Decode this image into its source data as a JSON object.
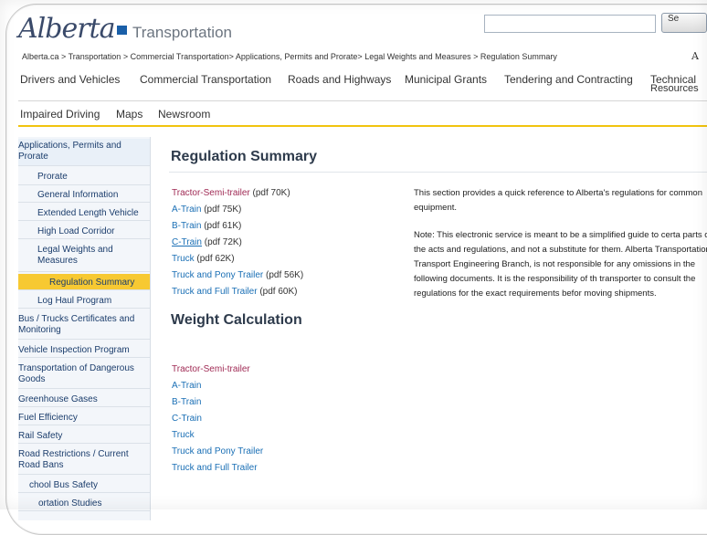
{
  "header": {
    "logo_text": "Alberta",
    "dept": "Transportation",
    "search_button": "Se"
  },
  "breadcrumb": "Alberta.ca > Transportation > Commercial Transportation> Applications, Permits and Prorate> Legal Weights and Measures > Regulation Summary",
  "font_size_label": "A",
  "nav_primary": [
    "Drivers and Vehicles",
    "Commercial Transportation",
    "Roads and Highways",
    "Municipal Grants",
    "Tendering and Contracting",
    "Technical",
    "Resources"
  ],
  "nav_secondary": [
    "Impaired Driving",
    "Maps",
    "Newsroom"
  ],
  "sidebar": [
    {
      "label": "Applications, Permits and Prorate",
      "level": "top"
    },
    {
      "label": "Prorate",
      "level": "sub"
    },
    {
      "label": "General Information",
      "level": "sub"
    },
    {
      "label": "Extended Length Vehicle",
      "level": "sub"
    },
    {
      "label": "High Load Corridor",
      "level": "sub"
    },
    {
      "label": "Legal Weights and Measures",
      "level": "sub"
    },
    {
      "label": "Regulation Summary",
      "level": "active"
    },
    {
      "label": "Log Haul Program",
      "level": "sub"
    },
    {
      "label": "Bus / Trucks Certificates and Monitoring",
      "level": "top"
    },
    {
      "label": "Vehicle Inspection Program",
      "level": "top"
    },
    {
      "label": "Transportation of Dangerous Goods",
      "level": "top"
    },
    {
      "label": "Greenhouse Gases",
      "level": "top"
    },
    {
      "label": "Fuel Efficiency",
      "level": "top"
    },
    {
      "label": "Rail Safety",
      "level": "top"
    },
    {
      "label": "Road Restrictions / Current Road Bans",
      "level": "top"
    },
    {
      "label": "chool Bus Safety",
      "level": "top"
    },
    {
      "label": "ortation Studies",
      "level": "top"
    }
  ],
  "main": {
    "title": "Regulation Summary",
    "pdf_links": [
      {
        "text": "Tractor-Semi-trailer",
        "meta": " (pdf 70K)"
      },
      {
        "text": "A-Train",
        "meta": " (pdf 75K)"
      },
      {
        "text": "B-Train",
        "meta": " (pdf 61K)"
      },
      {
        "text": "C-Train",
        "meta": " (pdf 72K)"
      },
      {
        "text": "Truck",
        "meta": " (pdf 62K)"
      },
      {
        "text": "Truck and Pony Trailer",
        "meta": " (pdf 56K)"
      },
      {
        "text": "Truck and Full Trailer",
        "meta": " (pdf 60K)"
      }
    ],
    "weight_title": "Weight Calculation",
    "weight_links": [
      "Tractor-Semi-trailer",
      "A-Train",
      "B-Train",
      "C-Train",
      "Truck",
      "Truck and Pony Trailer",
      "Truck and Full Trailer"
    ],
    "intro": "This section provides a quick reference to Alberta's regulations for common equipment.",
    "note": "Note: This electronic service is meant to be a simplified guide to certa parts of the acts and regulations, and not a substitute for them. Alberta Transportation, Transport Engineering Branch, is not responsible for any omissions in the following documents. It is the responsibility of th transporter to consult the regulations for the exact requirements befor moving shipments."
  }
}
